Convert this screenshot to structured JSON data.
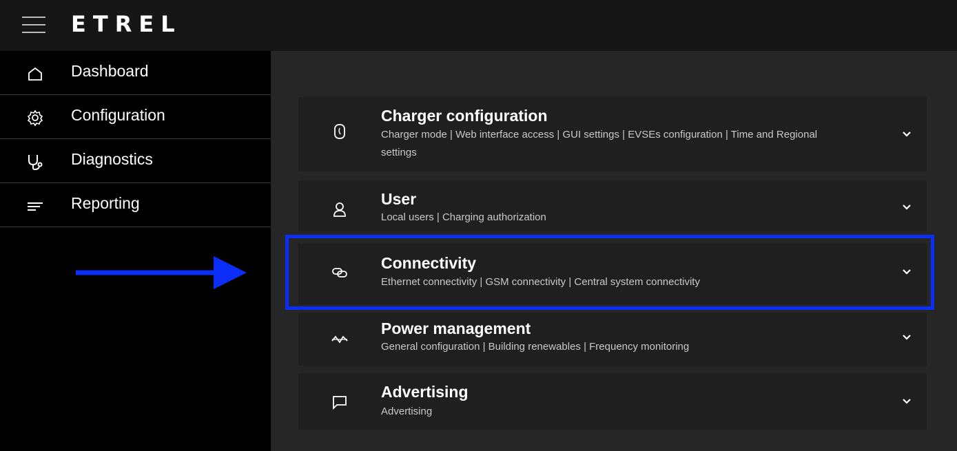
{
  "header": {
    "logo": "ETRΕL"
  },
  "sidebar": {
    "items": [
      {
        "label": "Dashboard",
        "icon": "home-icon"
      },
      {
        "label": "Configuration",
        "icon": "gear-icon"
      },
      {
        "label": "Diagnostics",
        "icon": "stethoscope-icon"
      },
      {
        "label": "Reporting",
        "icon": "lines-icon"
      }
    ]
  },
  "annotation": {
    "arrow_color": "#0a2ef5",
    "highlight_color": "#0a2ef5"
  },
  "main": {
    "cards": [
      {
        "title": "Charger configuration",
        "subtitle": "Charger mode  |  Web interface access  |  GUI settings  |  EVSEs configuration  |  Time and Regional settings",
        "icon": "plug-icon"
      },
      {
        "title": "User",
        "subtitle": "Local users  |  Charging authorization",
        "icon": "user-icon"
      },
      {
        "title": "Connectivity",
        "subtitle": "Ethernet connectivity  |  GSM connectivity  |  Central system connectivity",
        "icon": "link-icon"
      },
      {
        "title": "Power management",
        "subtitle": "General configuration  |  Building renewables  |  Frequency monitoring",
        "icon": "power-wave-icon"
      },
      {
        "title": "Advertising",
        "subtitle": "Advertising",
        "icon": "message-icon"
      }
    ]
  }
}
